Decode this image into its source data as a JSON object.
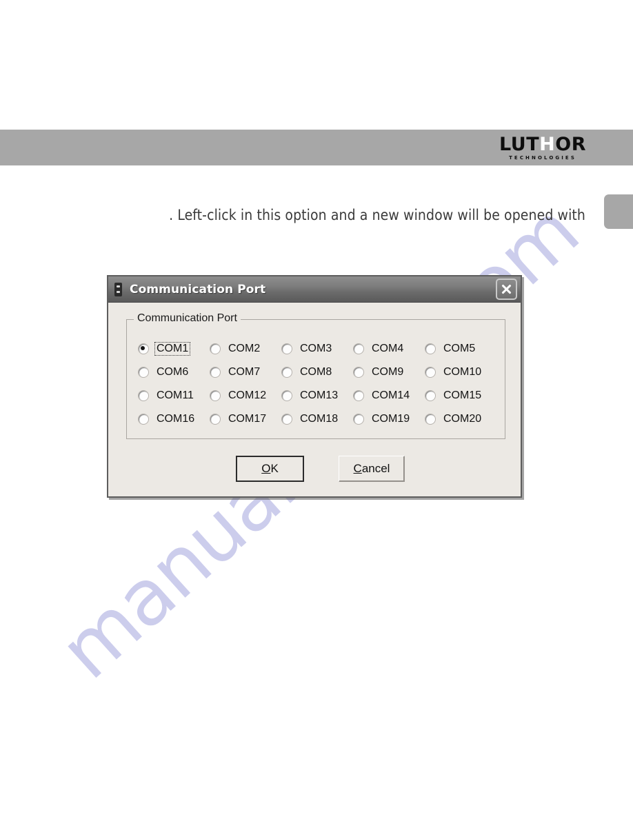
{
  "page": {
    "background_color": "#ffffff",
    "watermark_text": "manualshive.com",
    "watermark_color": "#b9bbe6"
  },
  "header": {
    "band_color": "#a7a7a7",
    "logo": {
      "part1": "LUT",
      "highlight": "H",
      "part2": "OR",
      "subtitle": "TECHNOLOGIES",
      "highlight_color": "#ffffff",
      "text_color": "#0d0d0d"
    },
    "side_tab_label": ""
  },
  "body": {
    "sentence": ". Left-click in this option and a new window will be opened with"
  },
  "dialog": {
    "title": "Communication Port",
    "icon_name": "serial-port-icon",
    "close_label": "✕",
    "group": {
      "legend": "Communication Port",
      "selected_value": "COM1",
      "options": [
        "COM1",
        "COM2",
        "COM3",
        "COM4",
        "COM5",
        "COM6",
        "COM7",
        "COM8",
        "COM9",
        "COM10",
        "COM11",
        "COM12",
        "COM13",
        "COM14",
        "COM15",
        "COM16",
        "COM17",
        "COM18",
        "COM19",
        "COM20"
      ]
    },
    "buttons": {
      "ok": {
        "accel": "O",
        "rest": "K",
        "is_default": true
      },
      "cancel": {
        "accel": "C",
        "rest": "ancel",
        "is_default": false
      }
    }
  }
}
